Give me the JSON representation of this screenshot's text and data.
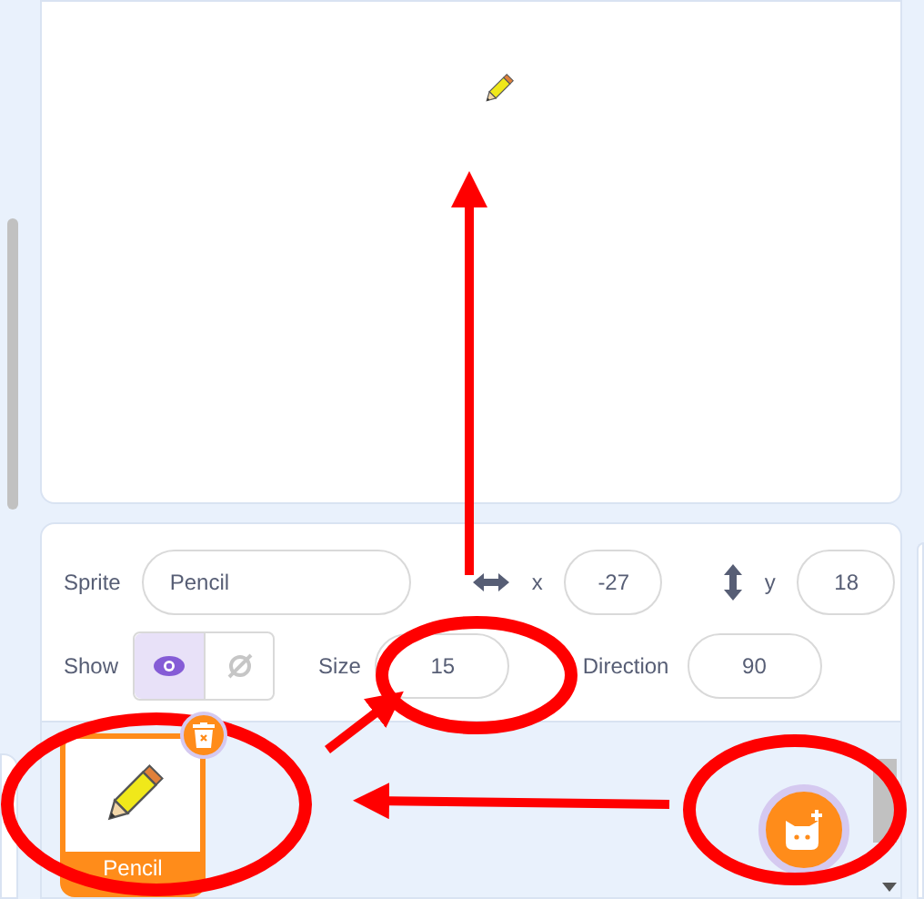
{
  "sprite": {
    "label": "Sprite",
    "name": "Pencil"
  },
  "x": {
    "label": "x",
    "value": "-27"
  },
  "y": {
    "label": "y",
    "value": "18"
  },
  "show": {
    "label": "Show",
    "visible": true
  },
  "size": {
    "label": "Size",
    "value": "15"
  },
  "direction": {
    "label": "Direction",
    "value": "90"
  },
  "sprites": [
    {
      "name": "Pencil",
      "selected": true
    }
  ]
}
